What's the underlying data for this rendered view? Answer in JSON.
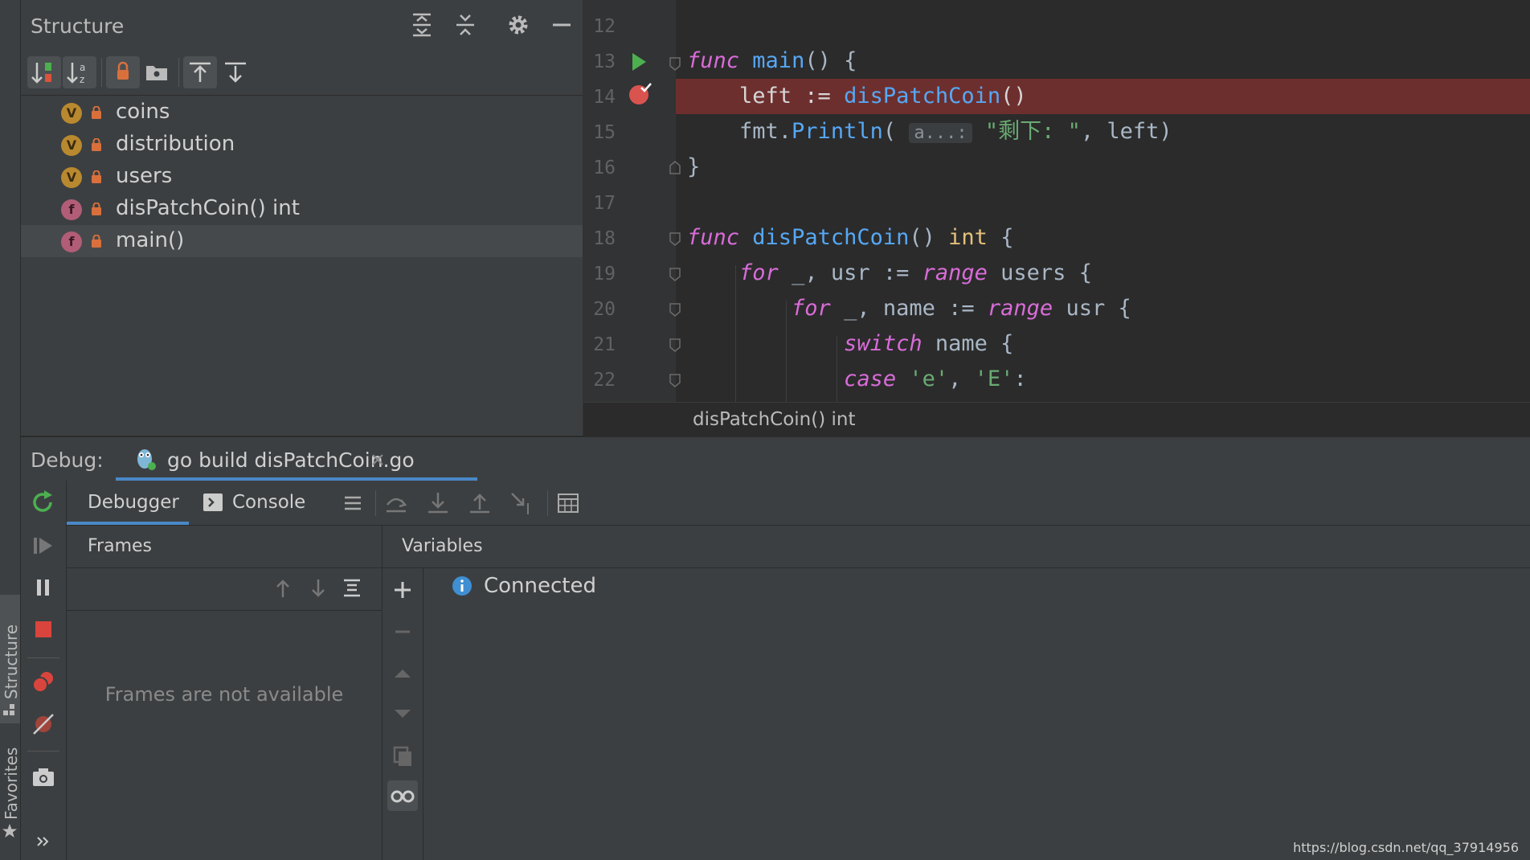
{
  "left_strip": {
    "structure_tab": "Structure",
    "favorites_tab": "Favorites"
  },
  "structure": {
    "title": "Structure",
    "items": [
      {
        "kind": "V",
        "label": "coins"
      },
      {
        "kind": "V",
        "label": "distribution"
      },
      {
        "kind": "V",
        "label": "users"
      },
      {
        "kind": "f",
        "label": "disPatchCoin() int"
      },
      {
        "kind": "f",
        "label": "main()",
        "selected": true
      }
    ]
  },
  "editor": {
    "line_numbers": [
      "12",
      "13",
      "14",
      "15",
      "16",
      "17",
      "18",
      "19",
      "20",
      "21",
      "22"
    ],
    "breadcrumb": "disPatchCoin() int",
    "param_hint": "a...:",
    "string_literal": "\"剩下: \"",
    "breakpoint_line": "14"
  },
  "debug": {
    "label": "Debug:",
    "run_config_tab": "go build disPatchCoin.go",
    "tabs": {
      "debugger": "Debugger",
      "console": "Console"
    },
    "frames": {
      "title": "Frames",
      "empty_message": "Frames are not available"
    },
    "variables": {
      "title": "Variables",
      "status": "Connected"
    }
  },
  "watermark": "https://blog.csdn.net/qq_37914956",
  "colors": {
    "panel_bg": "#3c3f41",
    "editor_bg": "#2b2b2b",
    "breakpoint_line": "#6d2f2e",
    "accent_blue": "#4a88c7",
    "keyword": "#d96cd9",
    "function": "#56a8f5",
    "string": "#6aab73"
  }
}
